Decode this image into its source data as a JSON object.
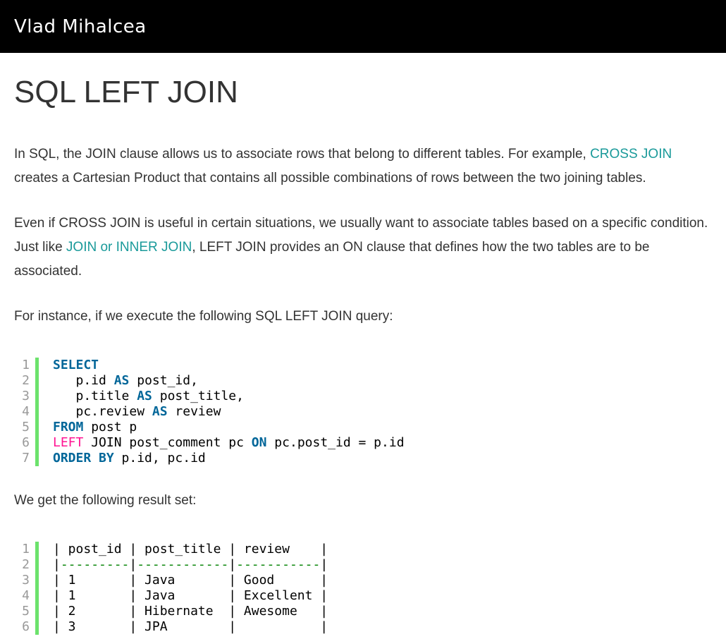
{
  "header": {
    "brand": "Vlad Mihalcea"
  },
  "article": {
    "title": "SQL LEFT JOIN",
    "p1_before_link": "In SQL, the JOIN clause allows us to associate rows that belong to different tables. For example, ",
    "p1_link": "CROSS JOIN",
    "p1_after_link": " creates a Cartesian Product that contains all possible combinations of rows between the two joining tables.",
    "p2_before_link": "Even if CROSS JOIN is useful in certain situations, we usually want to associate tables based on a specific condition. Just like ",
    "p2_link": "JOIN or INNER JOIN",
    "p2_after_link": ", LEFT JOIN provides an ON clause that defines how the two tables are to be associated.",
    "p3": "For instance, if we execute the following SQL LEFT JOIN query:",
    "p4": "We get the following result set:"
  },
  "query_code": {
    "line_numbers": [
      "1",
      "2",
      "3",
      "4",
      "5",
      "6",
      "7"
    ],
    "lines": [
      [
        {
          "t": "SELECT",
          "c": "kw"
        }
      ],
      [
        {
          "t": "   p.id ",
          "c": "plain"
        },
        {
          "t": "AS",
          "c": "kw"
        },
        {
          "t": " post_id,",
          "c": "plain"
        }
      ],
      [
        {
          "t": "   p.title ",
          "c": "plain"
        },
        {
          "t": "AS",
          "c": "kw"
        },
        {
          "t": " post_title,",
          "c": "plain"
        }
      ],
      [
        {
          "t": "   pc.review ",
          "c": "plain"
        },
        {
          "t": "AS",
          "c": "kw"
        },
        {
          "t": " review",
          "c": "plain"
        }
      ],
      [
        {
          "t": "FROM",
          "c": "kw"
        },
        {
          "t": " post p",
          "c": "plain"
        }
      ],
      [
        {
          "t": "LEFT",
          "c": "kw2"
        },
        {
          "t": " JOIN",
          "c": "plain"
        },
        {
          "t": " post_comment pc ",
          "c": "plain"
        },
        {
          "t": "ON",
          "c": "kw"
        },
        {
          "t": " pc.post_id = p.id",
          "c": "plain"
        }
      ],
      [
        {
          "t": "ORDER BY",
          "c": "kw"
        },
        {
          "t": " p.id, pc.id",
          "c": "plain"
        }
      ]
    ]
  },
  "result_code": {
    "line_numbers": [
      "1",
      "2",
      "3",
      "4",
      "5",
      "6"
    ],
    "lines": [
      [
        {
          "t": "| post_id | post_title | review    |",
          "c": "plain"
        }
      ],
      [
        {
          "t": "|",
          "c": "plain"
        },
        {
          "t": "---------",
          "c": "dash"
        },
        {
          "t": "|",
          "c": "plain"
        },
        {
          "t": "------------",
          "c": "dash"
        },
        {
          "t": "|",
          "c": "plain"
        },
        {
          "t": "-----------",
          "c": "dash"
        },
        {
          "t": "|",
          "c": "plain"
        }
      ],
      [
        {
          "t": "| 1       | Java       | Good      |",
          "c": "plain"
        }
      ],
      [
        {
          "t": "| 1       | Java       | Excellent |",
          "c": "plain"
        }
      ],
      [
        {
          "t": "| 2       | Hibernate  | Awesome   |",
          "c": "plain"
        }
      ],
      [
        {
          "t": "| 3       | JPA        |           |",
          "c": "plain"
        }
      ]
    ]
  },
  "colors": {
    "link": "#1a9a9a",
    "keyword": "#006699",
    "keyword_alt": "#ff1493",
    "gutter_bar": "#6ce26c",
    "header_bg": "#000000"
  }
}
